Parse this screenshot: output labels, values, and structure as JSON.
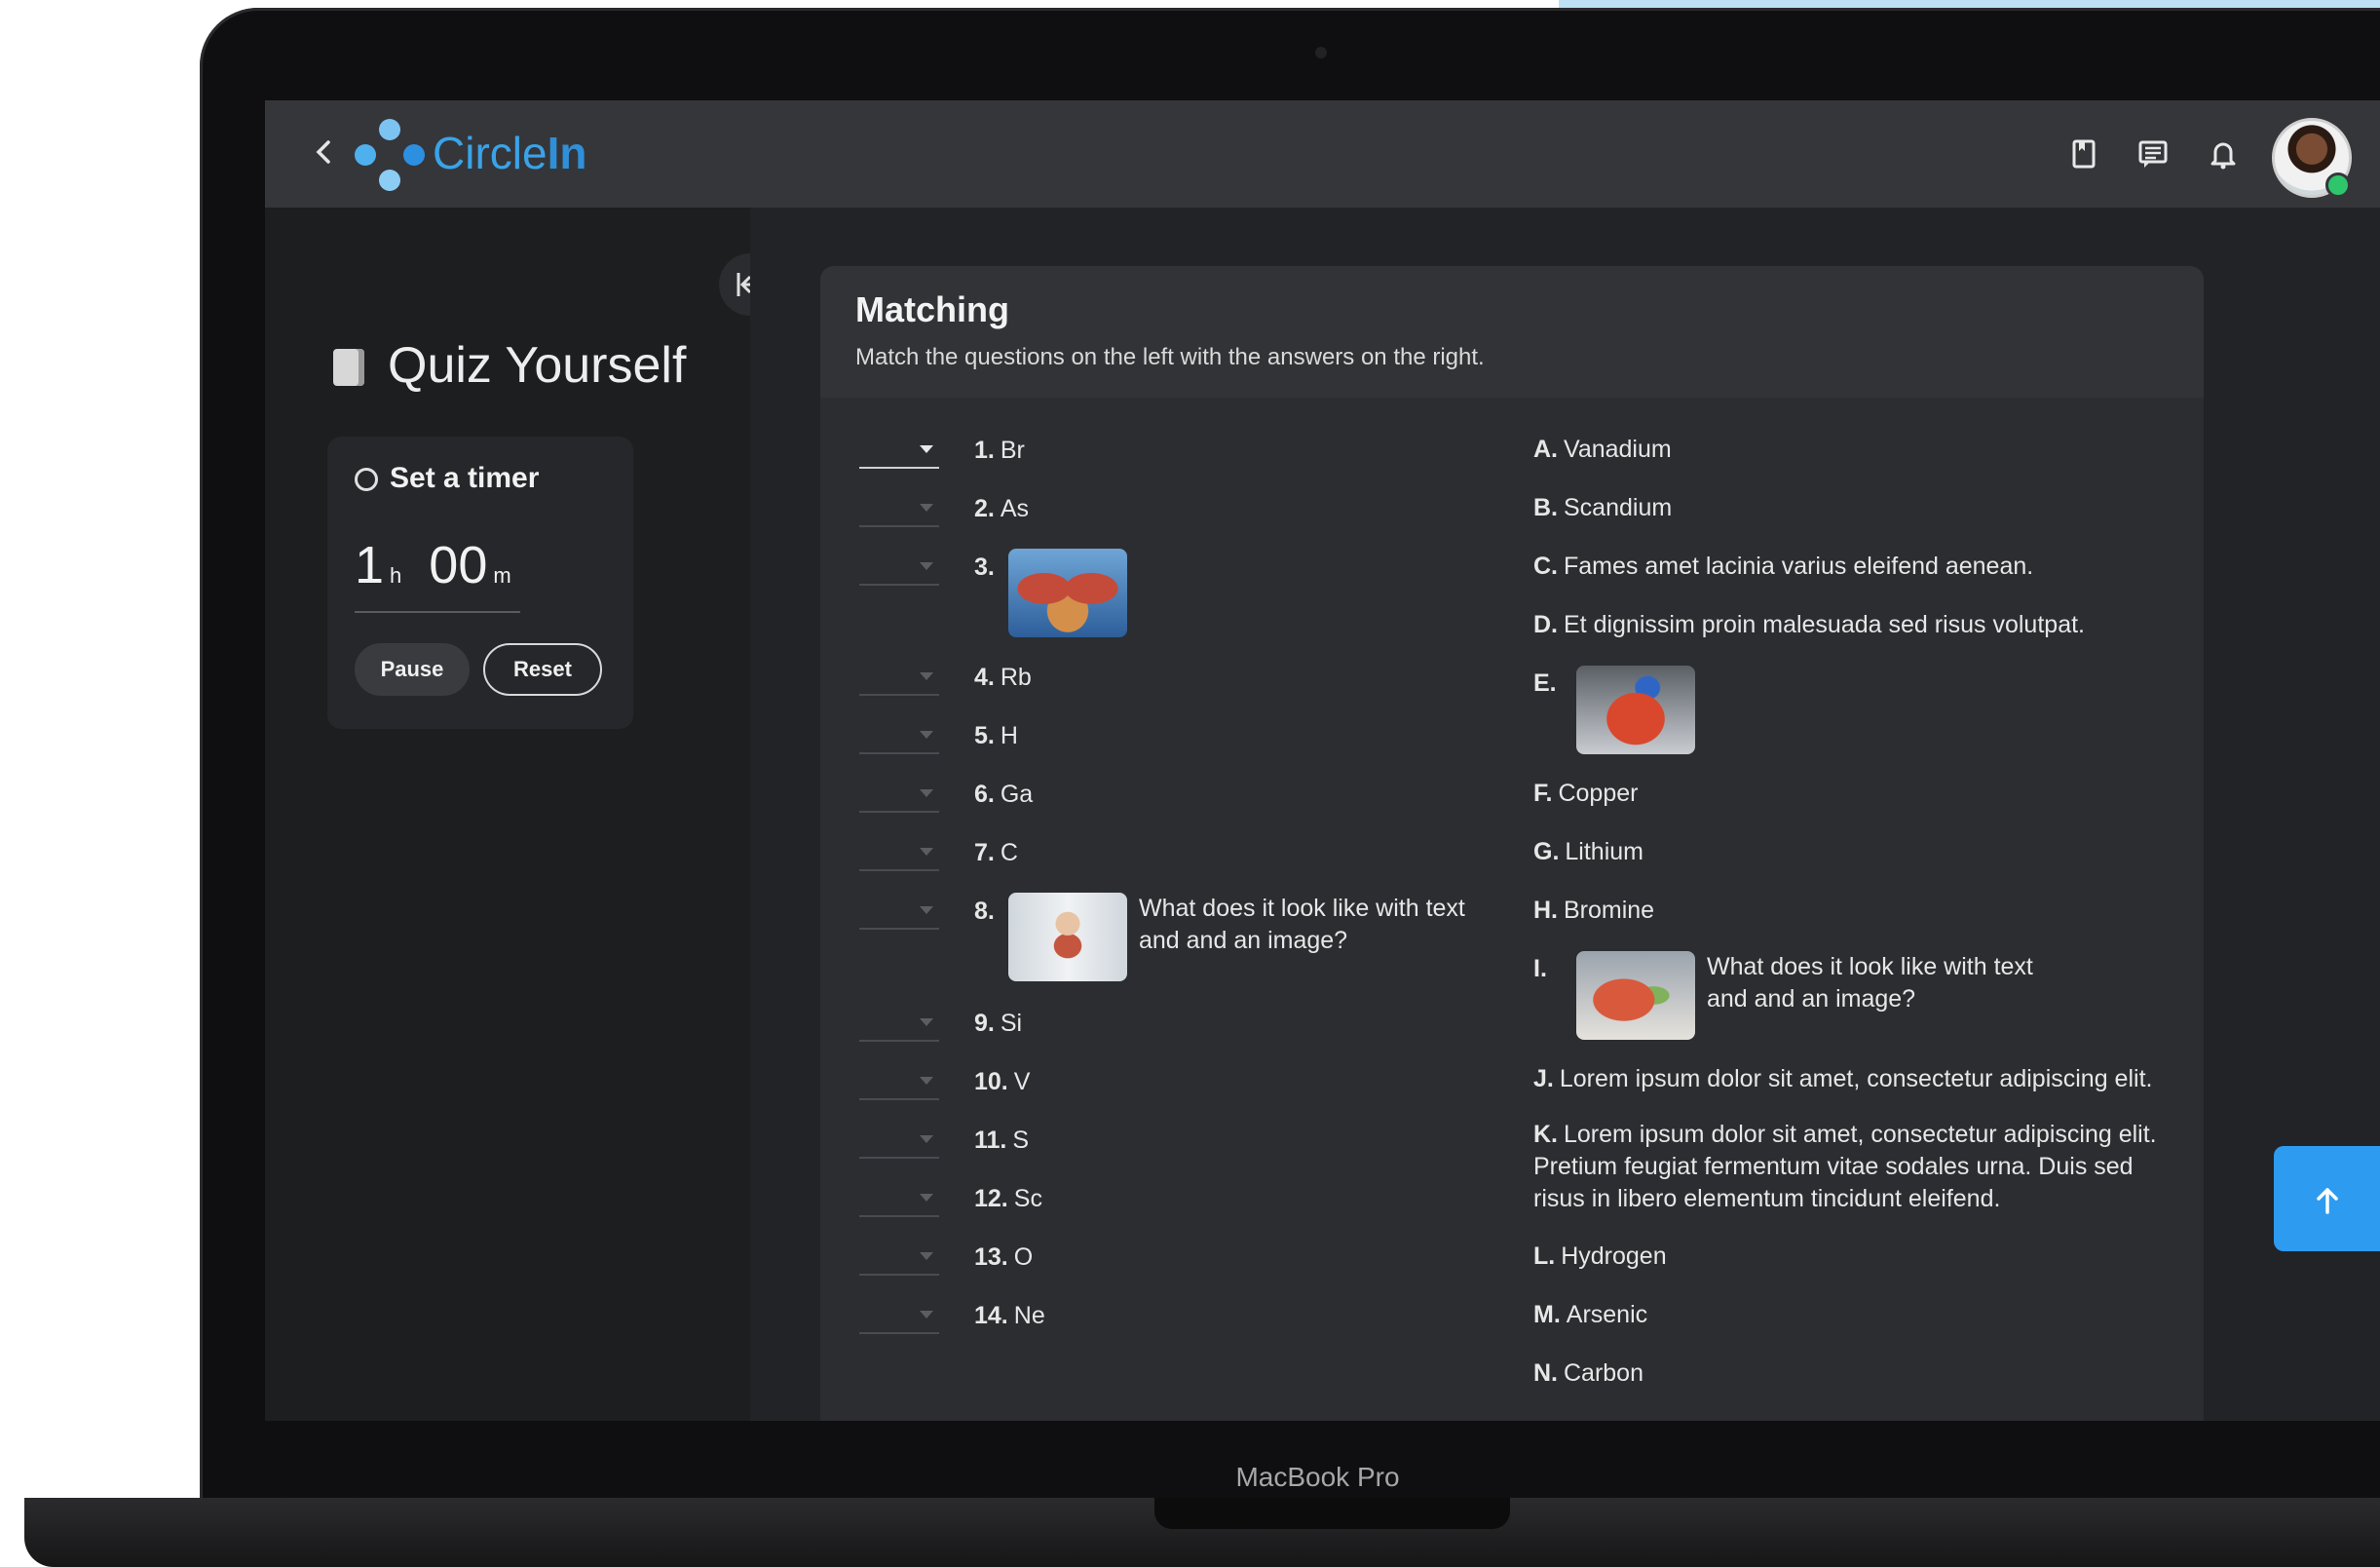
{
  "app": {
    "brand_regular": "Circle",
    "brand_bold": "In"
  },
  "device": {
    "label": "MacBook Pro"
  },
  "sidebar": {
    "title": "Quiz Yourself",
    "timer": {
      "label": "Set a timer",
      "hours": "1",
      "hours_unit": "h",
      "minutes": "00",
      "minutes_unit": "m",
      "pause_label": "Pause",
      "reset_label": "Reset"
    }
  },
  "matching": {
    "title": "Matching",
    "instructions": "Match the questions on the left with the answers on the right.",
    "questions": [
      {
        "num": "1.",
        "text": "Br"
      },
      {
        "num": "2.",
        "text": "As"
      },
      {
        "num": "3.",
        "text": "",
        "image": "lungs-anatomy-image"
      },
      {
        "num": "4.",
        "text": "Rb"
      },
      {
        "num": "5.",
        "text": "H"
      },
      {
        "num": "6.",
        "text": "Ga"
      },
      {
        "num": "7.",
        "text": "C"
      },
      {
        "num": "8.",
        "text": "What does it look like with text and and an image?",
        "image": "skeleton-model-image"
      },
      {
        "num": "9.",
        "text": "Si"
      },
      {
        "num": "10.",
        "text": "V"
      },
      {
        "num": "11.",
        "text": "S"
      },
      {
        "num": "12.",
        "text": "Sc"
      },
      {
        "num": "13.",
        "text": "O"
      },
      {
        "num": "14.",
        "text": "Ne"
      }
    ],
    "answers": [
      {
        "letter": "A.",
        "text": "Vanadium"
      },
      {
        "letter": "B.",
        "text": "Scandium"
      },
      {
        "letter": "C.",
        "text": "Fames amet lacinia varius eleifend aenean."
      },
      {
        "letter": "D.",
        "text": "Et dignissim proin malesuada sed risus volutpat."
      },
      {
        "letter": "E.",
        "text": "",
        "image": "heart-model-image"
      },
      {
        "letter": "F.",
        "text": "Copper"
      },
      {
        "letter": "G.",
        "text": "Lithium"
      },
      {
        "letter": "H.",
        "text": "Bromine"
      },
      {
        "letter": "I.",
        "text": "What does it look like with text and and an image?",
        "image": "heart-anatomy-image"
      },
      {
        "letter": "J.",
        "text": "Lorem ipsum dolor sit amet, consectetur adipiscing elit."
      },
      {
        "letter": "K.",
        "text": "Lorem ipsum dolor sit amet, consectetur adipiscing elit. Pretium feugiat fermentum vitae sodales urna. Duis sed risus in libero elementum tincidunt eleifend."
      },
      {
        "letter": "L.",
        "text": "Hydrogen"
      },
      {
        "letter": "M.",
        "text": "Arsenic"
      },
      {
        "letter": "N.",
        "text": "Carbon"
      }
    ]
  },
  "icons": {
    "back": "chevron-left-icon",
    "bookmark": "bookmark-icon",
    "chat": "chat-icon",
    "notifications": "bell-icon",
    "collapse": "collapse-left-icon",
    "scroll_top": "arrow-up-icon"
  },
  "colors": {
    "accent": "#2d9bf0",
    "brand": "#3aa3e8",
    "online": "#2ec56b"
  }
}
